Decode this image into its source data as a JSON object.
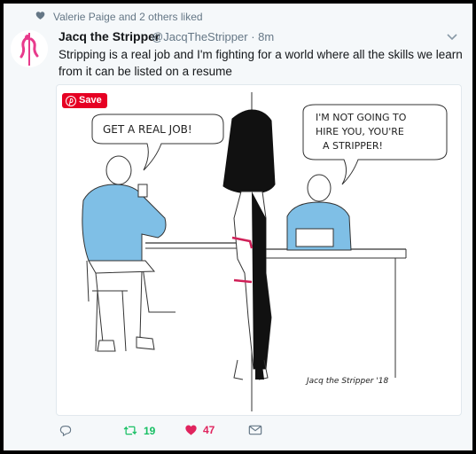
{
  "social_context": {
    "text": "Valerie Paige and 2 others liked"
  },
  "tweet": {
    "author_name": "Jacq the Stripper",
    "handle_time": "@JacqTheStripper · 8m",
    "text": "Stripping is a real job and I'm fighting for a world where all the skills we learn from it can be listed on a resume"
  },
  "media": {
    "save_label": "Save",
    "bubble_left": "GET A REAL JOB!",
    "bubble_right_1": "I'M NOT GOING TO",
    "bubble_right_2": "HIRE YOU, YOU'RE",
    "bubble_right_3": "A STRIPPER!",
    "signature": "Jacq the Stripper '18"
  },
  "actions": {
    "retweet_count": "19",
    "like_count": "47"
  },
  "colors": {
    "retweet": "#17bf63",
    "like": "#e0245e",
    "muted": "#657786",
    "pinterest": "#e60023"
  }
}
